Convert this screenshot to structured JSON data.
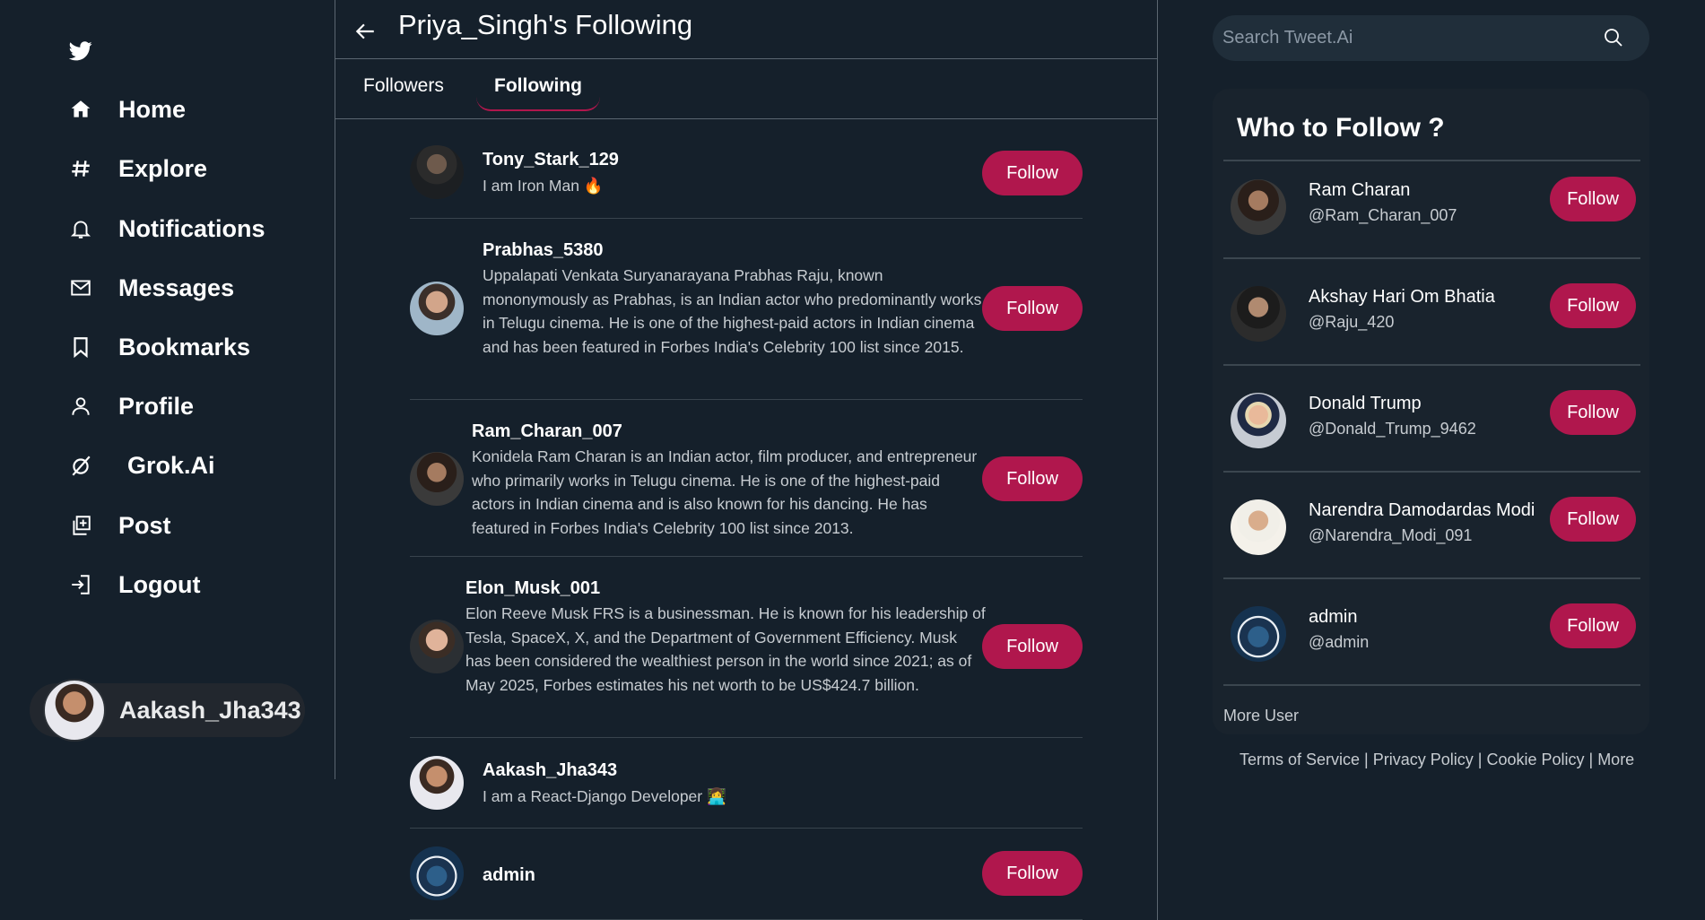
{
  "nav": {
    "logo_icon": "twitter-bird-icon",
    "items": [
      {
        "label": "Home",
        "icon": "home-icon"
      },
      {
        "label": "Explore",
        "icon": "hashtag-icon"
      },
      {
        "label": "Notifications",
        "icon": "bell-icon"
      },
      {
        "label": "Messages",
        "icon": "mail-icon"
      },
      {
        "label": "Bookmarks",
        "icon": "bookmark-icon"
      },
      {
        "label": "Profile",
        "icon": "user-icon"
      },
      {
        "label": "Grok.Ai",
        "icon": "grok-icon"
      },
      {
        "label": "Post",
        "icon": "post-icon"
      },
      {
        "label": "Logout",
        "icon": "logout-icon"
      }
    ],
    "current_user": "Aakash_Jha343"
  },
  "header": {
    "title": "Priya_Singh's Following",
    "tabs": [
      {
        "label": "Followers",
        "active": false
      },
      {
        "label": "Following",
        "active": true
      }
    ]
  },
  "users": [
    {
      "name": "Tony_Stark_129",
      "bio": "I am Iron Man 🔥",
      "button": "Follow"
    },
    {
      "name": "Prabhas_5380",
      "bio": "Uppalapati Venkata Suryanarayana Prabhas Raju, known mononymously as Prabhas, is an Indian actor who predominantly works in Telugu cinema. He is one of the highest-paid actors in Indian cinema and has been featured in Forbes India's Celebrity 100 list since 2015.",
      "button": "Follow"
    },
    {
      "name": "Ram_Charan_007",
      "bio": "Konidela Ram Charan is an Indian actor, film producer, and entrepreneur who primarily works in Telugu cinema. He is one of the highest-paid actors in Indian cinema and is also known for his dancing. He has featured in Forbes India's Celebrity 100 list since 2013.",
      "button": "Follow"
    },
    {
      "name": "Elon_Musk_001",
      "bio": "Elon Reeve Musk FRS is a businessman. He is known for his leadership of Tesla, SpaceX, X, and the Department of Government Efficiency. Musk has been considered the wealthiest person in the world since 2021; as of May 2025, Forbes estimates his net worth to be US$424.7 billion.",
      "button": "Follow"
    },
    {
      "name": "Aakash_Jha343",
      "bio": "I am a React-Django Developer 👩‍💻"
    },
    {
      "name": "admin",
      "bio": "",
      "button": "Follow"
    }
  ],
  "search": {
    "placeholder": "Search Tweet.Ai"
  },
  "who_to_follow": {
    "title": "Who to Follow ?",
    "users": [
      {
        "name": "Ram Charan",
        "handle": "@Ram_Charan_007",
        "button": "Follow"
      },
      {
        "name": "Akshay Hari Om Bhatia",
        "handle": "@Raju_420",
        "button": "Follow"
      },
      {
        "name": "Donald Trump",
        "handle": "@Donald_Trump_9462",
        "button": "Follow"
      },
      {
        "name": "Narendra Damodardas Modi",
        "handle": "@Narendra_Modi_091",
        "button": "Follow"
      },
      {
        "name": "admin",
        "handle": "@admin",
        "button": "Follow"
      }
    ],
    "more": "More User"
  },
  "footer": {
    "links": [
      "Terms of Service",
      "Privacy Policy",
      "Cookie Policy",
      "More"
    ],
    "separator": " | "
  },
  "colors": {
    "background": "#15202b",
    "accent": "#b0174d",
    "card": "#19232d",
    "muted_text": "#c7ccd1"
  }
}
